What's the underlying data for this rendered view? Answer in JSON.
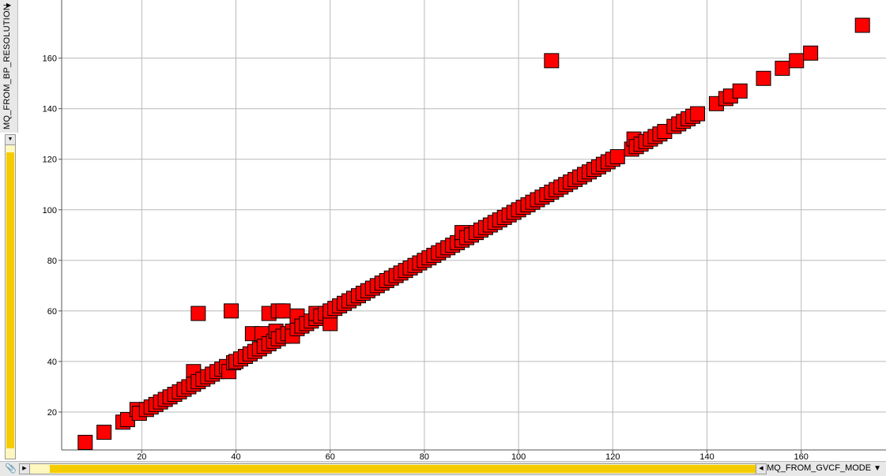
{
  "chart_data": {
    "type": "scatter",
    "xlabel": "MQ_FROM_GVCF_MODE",
    "ylabel": "MQ_FROM_BP_RESOLUTION",
    "xlim": [
      3,
      178
    ],
    "ylim": [
      5,
      183
    ],
    "x_ticks": [
      20,
      40,
      60,
      80,
      100,
      120,
      140,
      160
    ],
    "y_ticks": [
      20,
      40,
      60,
      80,
      100,
      120,
      140,
      160
    ],
    "grid": true,
    "marker": "square",
    "marker_color": "#ff0000",
    "marker_edge": "#000000",
    "points": [
      [
        8,
        8
      ],
      [
        12,
        12
      ],
      [
        16,
        16
      ],
      [
        17,
        17
      ],
      [
        19,
        21
      ],
      [
        19.5,
        19.5
      ],
      [
        21,
        21
      ],
      [
        22,
        22
      ],
      [
        23,
        23
      ],
      [
        24,
        24
      ],
      [
        25,
        25
      ],
      [
        26,
        26
      ],
      [
        27,
        27
      ],
      [
        28,
        28
      ],
      [
        29,
        29
      ],
      [
        30,
        30
      ],
      [
        31,
        36
      ],
      [
        31,
        31
      ],
      [
        32,
        32
      ],
      [
        32,
        59
      ],
      [
        33,
        33
      ],
      [
        34,
        34
      ],
      [
        35,
        35
      ],
      [
        36,
        36
      ],
      [
        37,
        37
      ],
      [
        38,
        38
      ],
      [
        38.5,
        36
      ],
      [
        39,
        60
      ],
      [
        39.5,
        39.5
      ],
      [
        40,
        40
      ],
      [
        41,
        41
      ],
      [
        42,
        42
      ],
      [
        43,
        43
      ],
      [
        43.5,
        51
      ],
      [
        44,
        44
      ],
      [
        45,
        45
      ],
      [
        45.5,
        51
      ],
      [
        46,
        46
      ],
      [
        47,
        59
      ],
      [
        47,
        47
      ],
      [
        48,
        48
      ],
      [
        48.5,
        52
      ],
      [
        49,
        49
      ],
      [
        49,
        60
      ],
      [
        50,
        50
      ],
      [
        50,
        60
      ],
      [
        51,
        51
      ],
      [
        52,
        52
      ],
      [
        52,
        50
      ],
      [
        53,
        53
      ],
      [
        53,
        58
      ],
      [
        54,
        54
      ],
      [
        55,
        55
      ],
      [
        56,
        56
      ],
      [
        57,
        57
      ],
      [
        57,
        59
      ],
      [
        58,
        58
      ],
      [
        59,
        59
      ],
      [
        60,
        55
      ],
      [
        60,
        60
      ],
      [
        61,
        61
      ],
      [
        62,
        62
      ],
      [
        63,
        63
      ],
      [
        64,
        64
      ],
      [
        65,
        65
      ],
      [
        66,
        66
      ],
      [
        67,
        67
      ],
      [
        68,
        68
      ],
      [
        69,
        69
      ],
      [
        70,
        70
      ],
      [
        71,
        71
      ],
      [
        72,
        72
      ],
      [
        73,
        73
      ],
      [
        74,
        74
      ],
      [
        75,
        75
      ],
      [
        76,
        76
      ],
      [
        77,
        77
      ],
      [
        78,
        78
      ],
      [
        79,
        79
      ],
      [
        80,
        80
      ],
      [
        81,
        81
      ],
      [
        82,
        82
      ],
      [
        83,
        83
      ],
      [
        84,
        84
      ],
      [
        85,
        85
      ],
      [
        86,
        86
      ],
      [
        87,
        87
      ],
      [
        88,
        88
      ],
      [
        88,
        91
      ],
      [
        89,
        89
      ],
      [
        90,
        90
      ],
      [
        91,
        91
      ],
      [
        92,
        92
      ],
      [
        93,
        93
      ],
      [
        94,
        94
      ],
      [
        95,
        95
      ],
      [
        96,
        96
      ],
      [
        97,
        97
      ],
      [
        98,
        98
      ],
      [
        99,
        99
      ],
      [
        100,
        100
      ],
      [
        101,
        101
      ],
      [
        102,
        102
      ],
      [
        103,
        103
      ],
      [
        104,
        104
      ],
      [
        105,
        105
      ],
      [
        106,
        106
      ],
      [
        107,
        107
      ],
      [
        107,
        159
      ],
      [
        108,
        108
      ],
      [
        109,
        109
      ],
      [
        110,
        110
      ],
      [
        111,
        111
      ],
      [
        112,
        112
      ],
      [
        113,
        113
      ],
      [
        114,
        114
      ],
      [
        115,
        115
      ],
      [
        116,
        116
      ],
      [
        117,
        117
      ],
      [
        118,
        118
      ],
      [
        119,
        119
      ],
      [
        120,
        120
      ],
      [
        121,
        121
      ],
      [
        124,
        124
      ],
      [
        124.5,
        128
      ],
      [
        125,
        125
      ],
      [
        126,
        126
      ],
      [
        127,
        127
      ],
      [
        128,
        128
      ],
      [
        129,
        129
      ],
      [
        130,
        130
      ],
      [
        131,
        131
      ],
      [
        133,
        133
      ],
      [
        134,
        134
      ],
      [
        135,
        135
      ],
      [
        136,
        136
      ],
      [
        137,
        137
      ],
      [
        138,
        138
      ],
      [
        142,
        142
      ],
      [
        144,
        144
      ],
      [
        145,
        145
      ],
      [
        147,
        147
      ],
      [
        152,
        152
      ],
      [
        156,
        156
      ],
      [
        159,
        159
      ],
      [
        162,
        162
      ],
      [
        173,
        173
      ]
    ]
  }
}
